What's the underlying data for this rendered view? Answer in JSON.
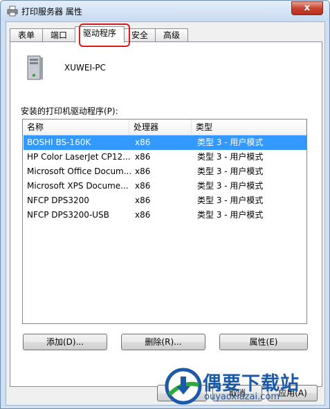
{
  "window": {
    "title": "打印服务器 属性",
    "close_label": "x"
  },
  "tabs": [
    {
      "label": "表单"
    },
    {
      "label": "端口"
    },
    {
      "label": "驱动程序",
      "active": true
    },
    {
      "label": "安全"
    },
    {
      "label": "高级"
    }
  ],
  "server": {
    "name": "XUWEI-PC"
  },
  "drivers": {
    "label": "安装的打印机驱动程序(P):",
    "columns": [
      "名称",
      "处理器",
      "类型"
    ],
    "rows": [
      {
        "name": "BOSHI BS-160K",
        "processor": "x86",
        "type": "类型 3 - 用户模式",
        "selected": true
      },
      {
        "name": "HP Color LaserJet CP12...",
        "processor": "x86",
        "type": "类型 3 - 用户模式"
      },
      {
        "name": "Microsoft Office Docum...",
        "processor": "x86",
        "type": "类型 3 - 用户模式"
      },
      {
        "name": "Microsoft XPS Docume...",
        "processor": "x86",
        "type": "类型 3 - 用户模式"
      },
      {
        "name": "NFCP DPS3200",
        "processor": "x86",
        "type": "类型 3 - 用户模式"
      },
      {
        "name": "NFCP DPS3200-USB",
        "processor": "x86",
        "type": "类型 3 - 用户模式"
      }
    ]
  },
  "buttons": {
    "add": "添加(D)...",
    "remove": "删除(R)...",
    "properties": "属性(E)",
    "ok": "确定",
    "cancel": "取消",
    "apply": "应用(A)"
  },
  "watermark": {
    "title": "偶要下载站",
    "url": "ouyaoxiazai.com"
  },
  "colors": {
    "selection": "#3399ff",
    "highlight_box": "#d41c1c",
    "watermark": "#1c5aa8"
  }
}
